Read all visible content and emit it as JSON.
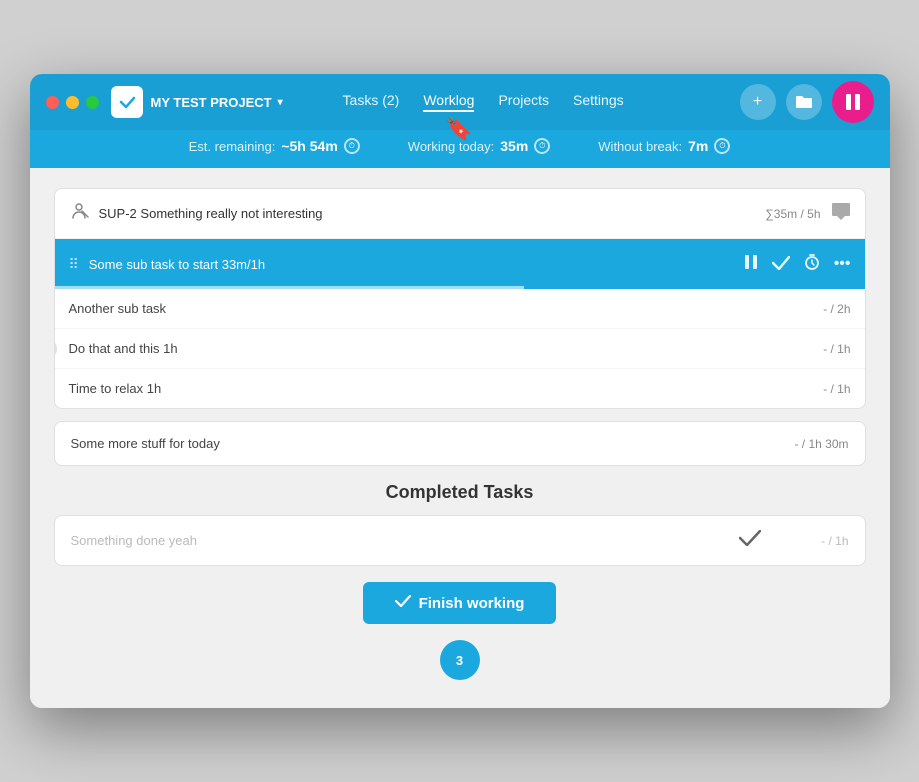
{
  "window": {
    "title": "MY TEST PROJECT"
  },
  "titlebar": {
    "project_label": "MY TEST PROJECT",
    "chevron": "▾",
    "nav": [
      {
        "label": "Tasks (2)",
        "active": false
      },
      {
        "label": "Worklog",
        "active": true
      },
      {
        "label": "Projects",
        "active": false
      },
      {
        "label": "Settings",
        "active": false
      }
    ],
    "add_btn": "+",
    "folder_btn": "🗂",
    "pause_btn": "⏸"
  },
  "subbar": {
    "est_remaining_label": "Est. remaining:",
    "est_remaining_value": "~5h 54m",
    "working_today_label": "Working today:",
    "working_today_value": "35m",
    "without_break_label": "Without break:",
    "without_break_value": "7m"
  },
  "task_card": {
    "icon": "⚙",
    "id": "SUP-2",
    "title": "Something really not interesting",
    "meta": "∑35m / 5h",
    "active_subtask": {
      "name": "Some sub task to start 33m/1h",
      "progress": 58
    },
    "subtasks": [
      {
        "name": "Another sub task",
        "time": "- / 2h"
      },
      {
        "name": "Do that and this 1h",
        "time": "- / 1h"
      },
      {
        "name": "Time to relax 1h",
        "time": "- / 1h"
      }
    ]
  },
  "single_task": {
    "name": "Some more stuff for today",
    "time": "- / 1h 30m"
  },
  "completed_section": {
    "title": "Completed Tasks",
    "tasks": [
      {
        "name": "Something done yeah",
        "time": "- / 1h"
      }
    ]
  },
  "finish_btn": {
    "label": "Finish working",
    "icon": "✔"
  },
  "bottom_badge": {
    "count": "3"
  }
}
